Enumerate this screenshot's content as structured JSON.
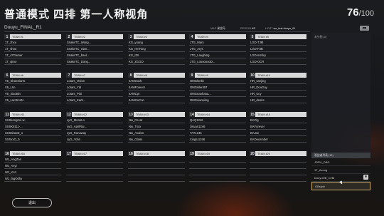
{
  "header": {
    "title": "普通模式 四排 第一人称视角",
    "players_current": "76",
    "players_max": "/100",
    "room_name": "Douyu_FINAL_R1",
    "map_label": "MAP",
    "map_value": "米拉玛",
    "region_label": "REGION",
    "region_value": "AS",
    "host_label": "HOST",
    "host_value": "ws_test-douyu_01"
  },
  "teams": [
    {
      "num": "1",
      "label": "TEAM #1",
      "players": [
        "1T_zhxx",
        "1T_shou",
        "1T_47Gamer",
        "1T_qimo"
      ]
    },
    {
      "num": "2",
      "label": "TEAM #2",
      "players": [
        "SnakeTC_Wang...",
        "SnakeTC_Xian...",
        "SnakeTC_baol...",
        "SnakeTC_Dong..."
      ]
    },
    {
      "num": "3",
      "label": "TEAM #3",
      "players": [
        "KG_yuang",
        "KG_HeiTong",
        "KG_IZII",
        "KG_ZGGO"
      ]
    },
    {
      "num": "4",
      "label": "TEAM #4",
      "players": [
        "JTG_Mars",
        "JTG_Arys",
        "JTG_Laughing",
        "JTG_LoooooooD..."
      ]
    },
    {
      "num": "5",
      "label": "TEAM #5",
      "players": [
        "LGD-TJM",
        "LGD-F3B",
        "LGD-meficy",
        "LGD-OCR"
      ]
    },
    {
      "num": "6",
      "label": "TEAM #6",
      "players": [
        "V5_ShanSianK",
        "V5_Lnn",
        "V5_XiaoBin",
        "V5_LarotronN"
      ]
    },
    {
      "num": "7",
      "label": "TEAM #7",
      "players": [
        "Lotars_Onion",
        "Lotars_YdI",
        "Lotars_Pipi",
        "Lotars_Karb..."
      ]
    },
    {
      "num": "8",
      "label": "TEAM #8",
      "players": [
        "4AMGodv",
        "4AMForever",
        "4AMCpt",
        "4AMGuCon"
      ]
    },
    {
      "num": "9",
      "label": "TEAM #9",
      "players": [
        "OMGlonkk",
        "OMGsilent97",
        "OMGnaohaoa...",
        "OMGxiaoniing"
      ]
    },
    {
      "num": "10",
      "label": "TEAM #10",
      "players": [
        "HR_sanjing",
        "HR_DouGay",
        "HR_Ucy",
        "HR_desire"
      ]
    },
    {
      "num": "11",
      "label": "TEAM #11",
      "players": [
        "SSSkongmo w-",
        "SSSK8111-...",
        "SSSshaoD_o",
        "SSSxxO_0"
      ]
    },
    {
      "num": "12",
      "label": "TEAM #12",
      "players": [
        "xyG_MoooLo",
        "xyG_AprilRai...",
        "xyG_Runaway",
        "xyG_Yofin"
      ]
    },
    {
      "num": "13",
      "label": "TEAM #13",
      "players": [
        "Nw_Pecar",
        "Nw_Txxx",
        "Nw_Avalon",
        "Nw_Glami"
      ]
    },
    {
      "num": "14",
      "label": "TEAM #14",
      "players": [
        "QAQ1246",
        "zisuan1246",
        "TAT1246",
        "Xingtu1246"
      ]
    },
    {
      "num": "15",
      "label": "TEAM #15",
      "players": [
        "BAPig",
        "BAForever",
        "BAJoe",
        "BADecember"
      ]
    },
    {
      "num": "16",
      "label": "TEAM #16",
      "players": [
        "Wz_AngZan",
        "Wz_Anyi",
        "Wz_IcUI",
        "Wz_fagOdhy"
      ]
    },
    {
      "num": "17",
      "label": "TEAM #17",
      "players": [
        "",
        "",
        "",
        ""
      ]
    },
    {
      "num": "18",
      "label": "TEAM #18",
      "players": [
        "",
        "",
        "",
        ""
      ]
    },
    {
      "num": "19",
      "label": "TEAM #19",
      "players": [
        "",
        "",
        "",
        ""
      ]
    },
    {
      "num": "20",
      "label": "TEAM #20",
      "players": [
        "",
        "",
        "",
        ""
      ]
    }
  ],
  "side_panel": {
    "title": "未分配 (0)"
  },
  "observers": {
    "title": "观战者列表 (12)",
    "rows": [
      "JDPH_OBD",
      "1T_Acong",
      "DouyuOB_CeBl",
      "OBstyle"
    ]
  },
  "footer": {
    "exit_label": "退出"
  }
}
